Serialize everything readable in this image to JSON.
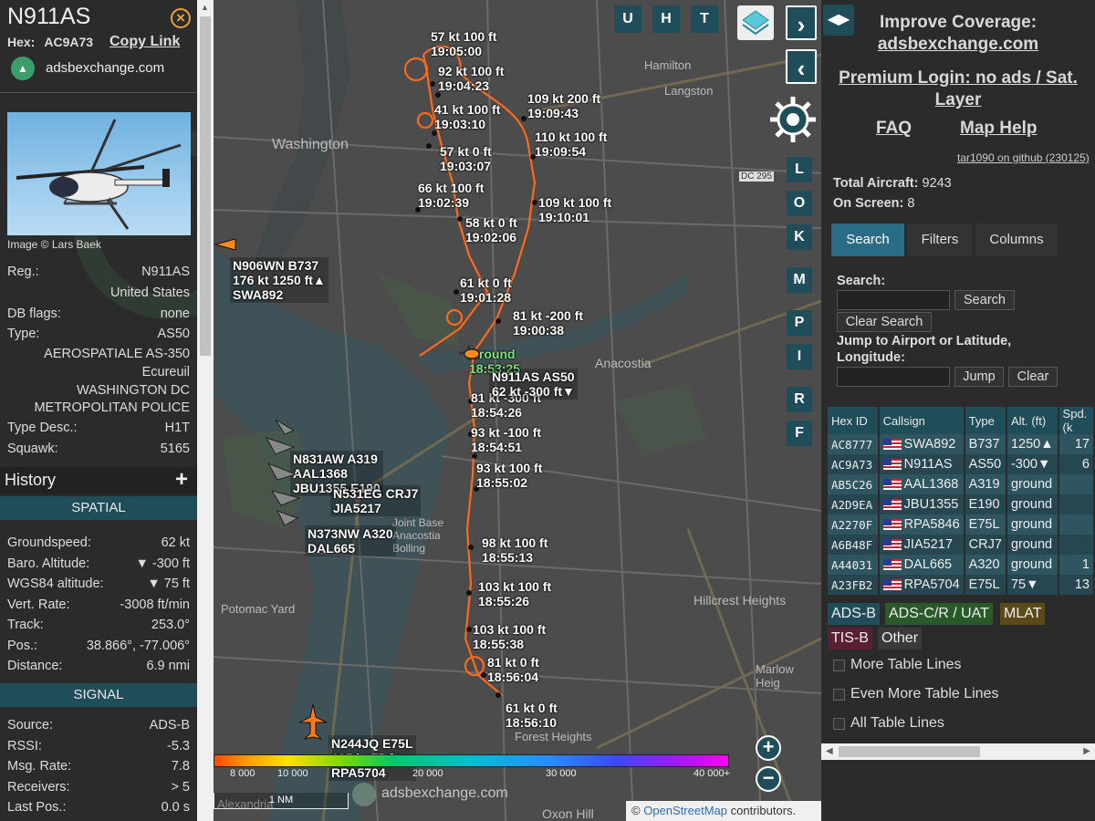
{
  "aircraft": {
    "callsign": "N911AS",
    "hex_label": "Hex:",
    "hex": "AC9A73",
    "copy_link": "Copy Link",
    "source_site": "adsbexchange.com",
    "image_credit": "Image © Lars Baek",
    "details": [
      {
        "key": "Reg.:",
        "value": "N911AS"
      },
      {
        "key": "",
        "value": "United States"
      },
      {
        "key": "DB flags:",
        "value": "none"
      },
      {
        "key": "Type:",
        "value": "AS50"
      },
      {
        "key": "",
        "value": "AEROSPATIALE AS-350"
      },
      {
        "key": "",
        "value": "Ecureuil"
      },
      {
        "key": "",
        "value": "WASHINGTON DC"
      },
      {
        "key": "",
        "value": "METROPOLITAN POLICE"
      },
      {
        "key": "Type Desc.:",
        "value": "H1T"
      },
      {
        "key": "Squawk:",
        "value": "5165"
      }
    ],
    "history_title": "History",
    "spatial_title": "SPATIAL",
    "spatial": [
      {
        "key": "Groundspeed:",
        "value": "62 kt"
      },
      {
        "key": "Baro. Altitude:",
        "value": "▼ -300 ft"
      },
      {
        "key": "WGS84 altitude:",
        "value": "▼ 75 ft"
      },
      {
        "key": "Vert. Rate:",
        "value": "-3008 ft/min"
      },
      {
        "key": "Track:",
        "value": "253.0°"
      },
      {
        "key": "Pos.:",
        "value": "38.866°, -77.006°"
      },
      {
        "key": "Distance:",
        "value": "6.9 nmi"
      }
    ],
    "signal_title": "SIGNAL",
    "signal": [
      {
        "key": "Source:",
        "value": "ADS-B"
      },
      {
        "key": "RSSI:",
        "value": "-5.3"
      },
      {
        "key": "Msg. Rate:",
        "value": "7.8"
      },
      {
        "key": "Receivers:",
        "value": "> 5"
      },
      {
        "key": "Last Pos.:",
        "value": "0.0 s"
      }
    ]
  },
  "map": {
    "places": [
      "Washington",
      "Hamilton",
      "Langston",
      "Hillcrest Heights",
      "Anacostia",
      "Marlow Heig",
      "Forest Heights",
      "Oxon Hill",
      "Potomac Yard",
      "Alexandria",
      "Joint Base Anacostia Bolling",
      "DC 295"
    ],
    "track_labels": [
      {
        "t1": "57 kt  100 ft",
        "t2": "19:05:00"
      },
      {
        "t1": "92 kt  100 ft",
        "t2": "19:04:23"
      },
      {
        "t1": "41 kt  100 ft",
        "t2": "19:03:10"
      },
      {
        "t1": "57 kt    0 ft",
        "t2": "19:03:07"
      },
      {
        "t1": "66 kt  100 ft",
        "t2": "19:02:39"
      },
      {
        "t1": "58 kt    0 ft",
        "t2": "19:02:06"
      },
      {
        "t1": "61 kt    0 ft",
        "t2": "19:01:28"
      },
      {
        "t1": "81 kt  -200 ft",
        "t2": "19:00:38"
      },
      {
        "t1": "109 kt  200 ft",
        "t2": "19:09:43"
      },
      {
        "t1": "110 kt  100 ft",
        "t2": "19:09:54"
      },
      {
        "t1": "109 kt  100 ft",
        "t2": "19:10:01"
      },
      {
        "t1": "Ground",
        "t2": "18:53:25"
      },
      {
        "t1": "81 kt  -300 ft",
        "t2": "18:54:26"
      },
      {
        "t1": "93 kt  -100 ft",
        "t2": "18:54:51"
      },
      {
        "t1": "93 kt  100 ft",
        "t2": "18:55:02"
      },
      {
        "t1": "98 kt  100 ft",
        "t2": "18:55:13"
      },
      {
        "t1": "103 kt  100 ft",
        "t2": "18:55:26"
      },
      {
        "t1": "103 kt  100 ft",
        "t2": "18:55:38"
      },
      {
        "t1": "81 kt    0 ft",
        "t2": "18:56:04"
      },
      {
        "t1": "61 kt    0 ft",
        "t2": "18:56:10"
      }
    ],
    "aircraft_labels": [
      {
        "l1": "N906WN B737",
        "l2": "176 kt  1250 ft▲",
        "l3": "SWA892"
      },
      {
        "l1": "N911AS AS50",
        "l2": "62 kt  -300 ft▼",
        "l3": ""
      },
      {
        "l1": "N831AW A319",
        "l2": "AAL1368",
        "l3": "JBU1355 E190"
      },
      {
        "l1": "N531EG CRJ7",
        "l2": "JIA5217",
        "l3": ""
      },
      {
        "l1": "N373NW A320",
        "l2": "DAL665",
        "l3": ""
      },
      {
        "l1": "N244JQ E75L",
        "l2": "125 kt  75 ft",
        "l3": "RPA5704"
      }
    ],
    "buttons_top": [
      "U",
      "H",
      "T"
    ],
    "buttons_side": [
      "L",
      "O",
      "K",
      "M",
      "P",
      "I",
      "R",
      "F"
    ],
    "altitude_scale": [
      "8 000",
      "10 000",
      "20 000",
      "30 000",
      "40 000+"
    ],
    "scale_bar": "1 NM",
    "watermark": "adsbexchange.com",
    "attribution_prefix": "©",
    "attribution_link": "OpenStreetMap",
    "attribution_suffix": "contributors."
  },
  "right": {
    "improve_title": "Improve Coverage:",
    "improve_link": "adsbexchange.com",
    "premium_line1": "Premium Login: no ads / Sat.",
    "premium_line2": "Layer",
    "faq": "FAQ",
    "map_help": "Map Help",
    "github": "tar1090 on github (230125)",
    "total_label": "Total Aircraft:",
    "total": "9243",
    "onscreen_label": "On Screen:",
    "onscreen": "8",
    "tabs": [
      "Search",
      "Filters",
      "Columns"
    ],
    "search_label": "Search:",
    "search_button": "Search",
    "clear_search": "Clear Search",
    "jump_label": "Jump to Airport or Latitude, Longitude:",
    "jump_button": "Jump",
    "clear_button": "Clear",
    "table_headers": [
      "Hex ID",
      "Callsign",
      "Type",
      "Alt. (ft)",
      "Spd. (k"
    ],
    "table_rows": [
      {
        "hex": "AC8777",
        "callsign": "SWA892",
        "type": "B737",
        "alt": "1250▲",
        "spd": "17"
      },
      {
        "hex": "AC9A73",
        "callsign": "N911AS",
        "type": "AS50",
        "alt": "-300▼",
        "spd": "6"
      },
      {
        "hex": "AB5C26",
        "callsign": "AAL1368",
        "type": "A319",
        "alt": "ground",
        "spd": ""
      },
      {
        "hex": "A2D9EA",
        "callsign": "JBU1355",
        "type": "E190",
        "alt": "ground",
        "spd": ""
      },
      {
        "hex": "A2270F",
        "callsign": "RPA5846",
        "type": "E75L",
        "alt": "ground",
        "spd": ""
      },
      {
        "hex": "A6B48F",
        "callsign": "JIA5217",
        "type": "CRJ7",
        "alt": "ground",
        "spd": ""
      },
      {
        "hex": "A44031",
        "callsign": "DAL665",
        "type": "A320",
        "alt": "ground",
        "spd": "1"
      },
      {
        "hex": "A23FB2",
        "callsign": "RPA5704",
        "type": "E75L",
        "alt": "75▼",
        "spd": "13"
      }
    ],
    "legend": [
      {
        "label": "ADS-B",
        "color": "#1f4d5a"
      },
      {
        "label": "ADS-C/R / UAT",
        "color": "#2a5a2a"
      },
      {
        "label": "MLAT",
        "color": "#5a4a1a"
      },
      {
        "label": "TIS-B",
        "color": "#5a1f33"
      },
      {
        "label": "Other",
        "color": "#3a3a3a"
      }
    ],
    "checkboxes": [
      "More Table Lines",
      "Even More Table Lines",
      "All Table Lines"
    ]
  }
}
